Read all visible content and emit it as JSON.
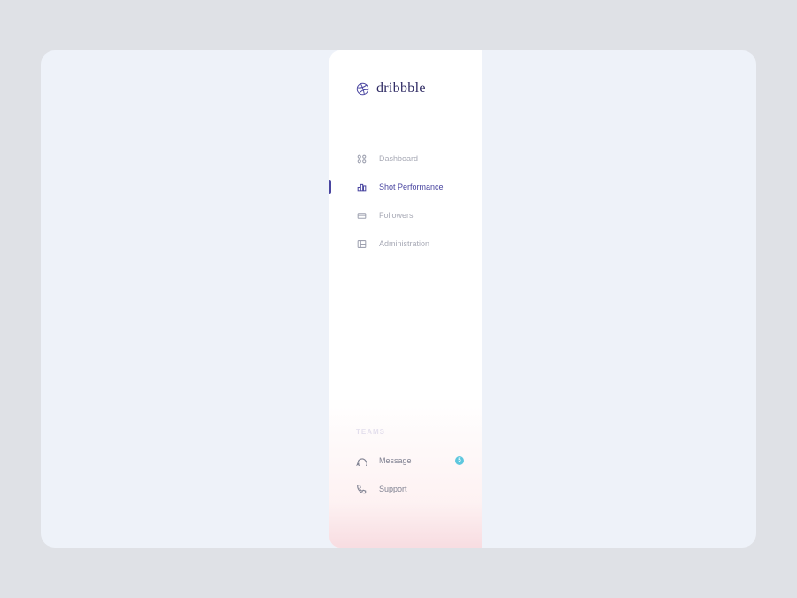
{
  "brand": {
    "name": "dribbble"
  },
  "nav": {
    "items": [
      {
        "label": "Dashboard",
        "icon": "grid-dots-icon",
        "active": false
      },
      {
        "label": "Shot Performance",
        "icon": "bar-chart-icon",
        "active": true
      },
      {
        "label": "Followers",
        "icon": "card-icon",
        "active": false
      },
      {
        "label": "Administration",
        "icon": "layout-icon",
        "active": false
      }
    ]
  },
  "teams": {
    "heading": "TEAMS",
    "items": [
      {
        "label": "Message",
        "icon": "chat-icon",
        "badge": "5"
      },
      {
        "label": "Support",
        "icon": "phone-icon",
        "badge": null
      }
    ]
  },
  "colors": {
    "accent": "#4945a0",
    "muted": "#a8aab6",
    "badge": "#5dc7de"
  }
}
